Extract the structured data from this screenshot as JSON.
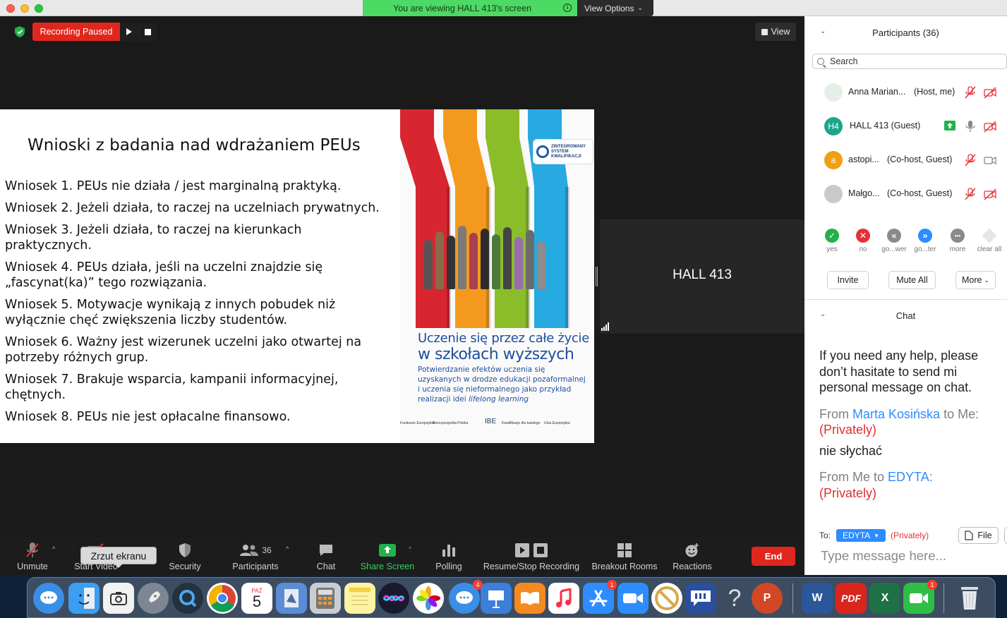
{
  "titlebar": {
    "banner": "You are viewing HALL 413's screen",
    "view_options": "View Options"
  },
  "stage": {
    "recording_status": "Recording Paused",
    "view_button": "View"
  },
  "slide": {
    "title": "Wnioski z badania nad wdrażaniem PEUs",
    "conclusions": [
      "Wniosek 1. PEUs nie działa / jest marginalną praktyką.",
      "Wniosek 2. Jeżeli działa, to raczej na uczelniach prywatnych.",
      "Wniosek 3. Jeżeli działa, to raczej na kierunkach praktycznych.",
      "Wniosek 4. PEUs działa, jeśli na uczelni znajdzie się „fascynat(ka)” tego rozwiązania.",
      "Wniosek 5. Motywacje wynikają z innych pobudek niż wyłącznie chęć zwiększenia liczby studentów.",
      "Wniosek 6. Ważny jest wizerunek uczelni jako otwartej na potrzeby różnych grup.",
      "Wniosek 7. Brakuje wsparcia, kampanii informacyjnej, chętnych.",
      "Wniosek 8. PEUs nie jest opłacalne finansowo."
    ],
    "poster": {
      "logo_text": [
        "ZINTEGROWANY",
        "SYSTEM",
        "KWALIFIKACJI"
      ],
      "heading_line1": "Uczenie się przez całe życie",
      "heading_line2": "w szkołach wyższych",
      "subtitle": "Potwierdzanie efektów uczenia się uzyskanych w drodze edukacji pozaformalnej i uczenia się nieformalnego jako przykład realizacji idei",
      "subtitle_italic": "lifelong learning",
      "stripe_colors": [
        "#d7262f",
        "#f39a1e",
        "#8bbd2b",
        "#27a9e1"
      ],
      "footer_logos": [
        "Fundusze Europejskie",
        "Rzeczpospolita Polska",
        "IBE",
        "Kwalifikacje dla każdego",
        "Unia Europejska"
      ]
    }
  },
  "tile": {
    "name": "HALL 413"
  },
  "toolbar": {
    "unmute": "Unmute",
    "start_video": "Start Video",
    "security": "Security",
    "participants": "Participants",
    "participants_count": "36",
    "chat": "Chat",
    "share_screen": "Share Screen",
    "polling": "Polling",
    "recording": "Resume/Stop Recording",
    "breakout": "Breakout Rooms",
    "reactions": "Reactions",
    "end": "End",
    "tooltip": "Zrzut ekranu"
  },
  "participants_panel": {
    "title": "Participants (36)",
    "search_placeholder": "Search",
    "people": [
      {
        "name": "Anna Marian...",
        "role": "(Host, me)",
        "avatar_initials": "",
        "avatar_color": "#e6efe6"
      },
      {
        "name": "HALL 413 (Guest)",
        "role": "",
        "avatar_initials": "H4",
        "avatar_color": "#1da58b"
      },
      {
        "name": "astopi...",
        "role": "(Co-host, Guest)",
        "avatar_initials": "a",
        "avatar_color": "#f0a012"
      },
      {
        "name": "Małgo...",
        "role": "(Co-host, Guest)",
        "avatar_initials": "",
        "avatar_color": "#c9c9c9"
      }
    ],
    "reactions": [
      {
        "label": "yes",
        "symbol": "✓",
        "color": "#22b14c"
      },
      {
        "label": "no",
        "symbol": "✕",
        "color": "#e5323a"
      },
      {
        "label": "go...wer",
        "symbol": "«",
        "color": "#8a8a8a"
      },
      {
        "label": "go...ter",
        "symbol": "»",
        "color": "#2d8cff"
      },
      {
        "label": "more",
        "symbol": "•••",
        "color": "#8a8a8a"
      },
      {
        "label": "clear all",
        "symbol": "",
        "color": "#e6e6e6"
      }
    ],
    "invite": "Invite",
    "mute_all": "Mute All",
    "more": "More"
  },
  "chat_panel": {
    "title": "Chat",
    "welcome": "If you need any help, please don’t hasitate to send mi personal message on chat.",
    "msg1_from_prefix": "From",
    "msg1_sender": "Marta Kosińska",
    "msg1_to": "to Me:",
    "msg1_privacy": "(Privately)",
    "msg1_text": "nie słychać",
    "msg2_from_prefix": "From Me to",
    "msg2_recipient": "EDYTA",
    "msg2_privacy": "(Privately)",
    "to_label": "To:",
    "to_recipient": "EDYTA",
    "to_privacy": "(Privately)",
    "file_button": "File",
    "more_button": "···",
    "input_placeholder": "Type message here..."
  },
  "dock": {
    "calendar_month": "PAŹ",
    "calendar_day": "5",
    "badge_messages": "4",
    "badge_appstore": "1",
    "badge_facetime": "1",
    "pdf_label": "PDF",
    "word_label": "W",
    "excel_label": "X",
    "ppt_label": "P"
  }
}
